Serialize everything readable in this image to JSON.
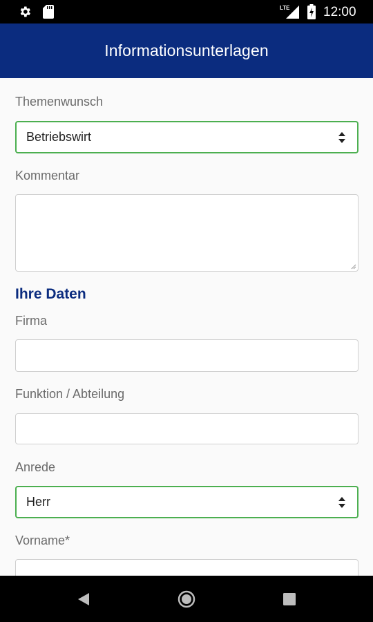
{
  "status_bar": {
    "time": "12:00",
    "network": "LTE",
    "icons": [
      "gear-icon",
      "sd-card-icon",
      "lte-signal-icon",
      "battery-icon"
    ]
  },
  "app_bar": {
    "title": "Informationsunterlagen"
  },
  "form": {
    "themenwunsch": {
      "label": "Themenwunsch",
      "value": "Betriebswirt"
    },
    "kommentar": {
      "label": "Kommentar",
      "value": ""
    },
    "section_title": "Ihre Daten",
    "firma": {
      "label": "Firma",
      "value": ""
    },
    "funktion": {
      "label": "Funktion / Abteilung",
      "value": ""
    },
    "anrede": {
      "label": "Anrede",
      "value": "Herr"
    },
    "vorname": {
      "label": "Vorname*",
      "value": ""
    }
  },
  "nav_bar": {
    "icons": [
      "back-icon",
      "home-icon",
      "recents-icon"
    ]
  },
  "colors": {
    "primary": "#0b2c7f",
    "select_border": "#4caf50",
    "label": "#6b6b6b"
  }
}
